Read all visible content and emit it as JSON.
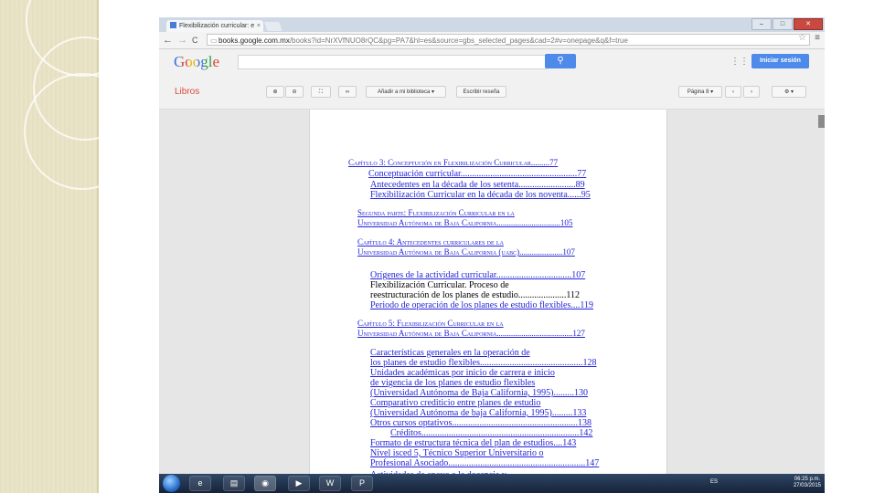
{
  "browser": {
    "tab_title": "Flexibilización curricular: e",
    "tab_close": "×",
    "url_prefix": "books.google.com.mx",
    "url_rest": "/books?id=NrXVfNUO8rQC&pg=PA7&hl=es&source=gbs_selected_pages&cad=2#v=onepage&q&f=true",
    "nav_back": "←",
    "nav_forward": "→",
    "nav_reload": "C",
    "window_min": "–",
    "window_max": "□",
    "window_close": "✕"
  },
  "google": {
    "logo": "Google",
    "search_icon": "search-icon",
    "sign_in": "Iniciar sesión"
  },
  "toolbar": {
    "section": "Libros",
    "add_library": "Añadir a mi biblioteca",
    "write_review": "Escribir reseña",
    "page_select": "Página 8"
  },
  "toc": [
    {
      "text": "Capítulo 3: Conceptución en Flexibilización Curricular.........77",
      "style": "sc link"
    },
    {
      "text": "Conceptuación curricular...................................................77",
      "style": "link"
    },
    {
      "text": "Antecedentes en la década de los setenta.........................89",
      "style": "link"
    },
    {
      "text": "Flexibilización Curricular en la década de los noventa......95",
      "style": "link"
    },
    {
      "text": "Segunda parte: Flexibilización Curricular en la",
      "style": "sc link"
    },
    {
      "text": "Universidad Autónoma de Baja California...............................105",
      "style": "sc link"
    },
    {
      "text": "Capítulo 4: Antecedentes curriculares de la",
      "style": "sc link"
    },
    {
      "text": "Universidad Autónoma de Baja California (uabc).....................107",
      "style": "sc link"
    },
    {
      "text": "Orígenes de la actividad curricular.................................107",
      "style": "link"
    },
    {
      "text": "Flexibilización Curricular. Proceso de",
      "style": "plain"
    },
    {
      "text": "reestructuración de los planes de estudio.....................112",
      "style": "plain"
    },
    {
      "text": "Periodo de operación de los planes de estudio flexibles....119",
      "style": "link"
    },
    {
      "text": "Capítulo 5: Flexibilización Curricular en la",
      "style": "sc link"
    },
    {
      "text": "Universidad Autónoma de Baja California.....................................127",
      "style": "sc link"
    },
    {
      "text": "Características generales en la operación de",
      "style": "link"
    },
    {
      "text": "los planes de estudio flexibles.............................................128",
      "style": "link"
    },
    {
      "text": "Unidades académicas por inicio de carrera e inicio",
      "style": "link"
    },
    {
      "text": "de vigencia de los planes de estudio flexibles",
      "style": "link"
    },
    {
      "text": "(Universidad Autónoma de Baja California, 1995).........130",
      "style": "link"
    },
    {
      "text": "Comparativo crediticio entre planes de estudio",
      "style": "link"
    },
    {
      "text": "(Universidad Autónoma de baja California, 1995).........133",
      "style": "link"
    },
    {
      "text": "Otros cursos optativos.......................................................138",
      "style": "link"
    },
    {
      "text": "Créditos.....................................................................142",
      "style": "link"
    },
    {
      "text": "Formato de estructura técnica del plan de estudios....143",
      "style": "link"
    },
    {
      "text": "Nivel isced 5, Técnico Superior Universitario o",
      "style": "link"
    },
    {
      "text": "Profesional Asociado............................................................147",
      "style": "link"
    },
    {
      "text": "Actividades de apoyo a la docencia y",
      "style": "link"
    }
  ],
  "taskbar": {
    "language": "ES",
    "time": "06:25 p.m.",
    "date": "27/03/2015"
  }
}
